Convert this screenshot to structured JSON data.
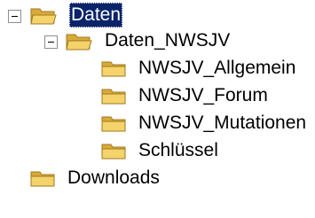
{
  "tree": {
    "root": {
      "label": "Daten",
      "expanded": true,
      "selected": true,
      "children": [
        {
          "label": "Daten_NWSJV",
          "expanded": true,
          "children": [
            {
              "label": "NWSJV_Allgemein"
            },
            {
              "label": "NWSJV_Forum"
            },
            {
              "label": "NWSJV_Mutationen"
            },
            {
              "label": "Schlüssel"
            }
          ]
        }
      ]
    },
    "sibling": {
      "label": "Downloads"
    }
  },
  "colors": {
    "selection_bg": "#0a246a",
    "folder_fill": "#f4d36b",
    "folder_dark": "#d9a93a",
    "folder_outline": "#a07a1e",
    "expander_border": "#8e8e8e"
  }
}
